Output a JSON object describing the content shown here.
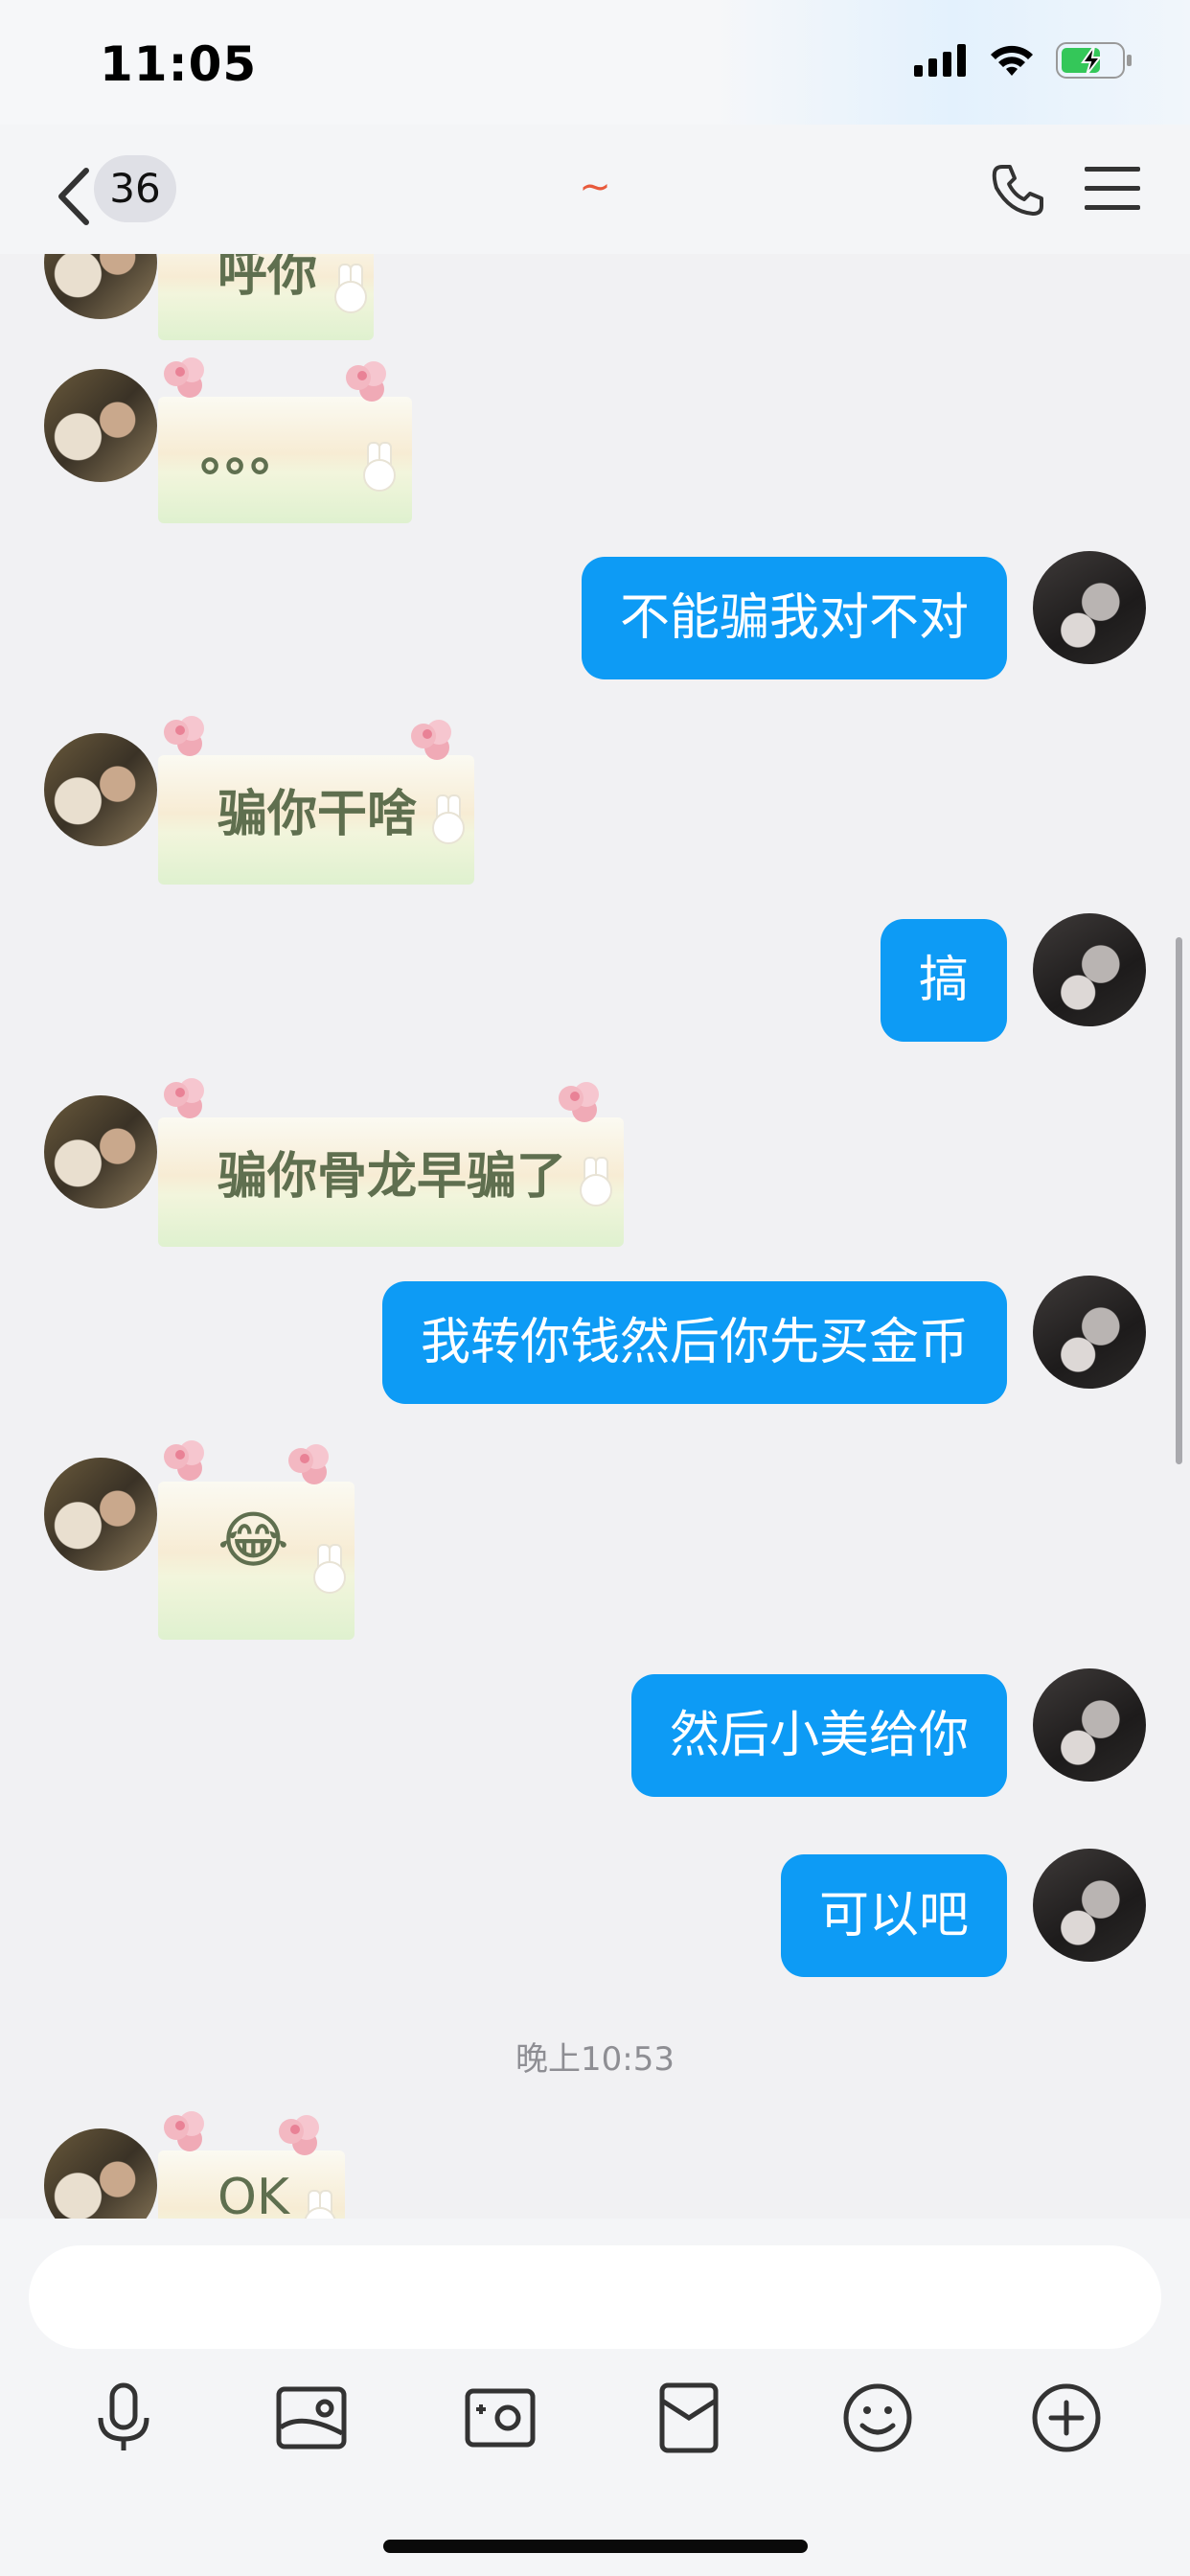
{
  "status_bar": {
    "time": "11:05"
  },
  "nav": {
    "badge_count": "36",
    "title": "~"
  },
  "messages": [
    {
      "side": "left",
      "kind": "sticker",
      "text": "呼你"
    },
    {
      "side": "left",
      "kind": "sticker",
      "text": "。。。"
    },
    {
      "side": "right",
      "kind": "text",
      "text": "不能骗我对不对"
    },
    {
      "side": "left",
      "kind": "sticker",
      "text": "骗你干啥"
    },
    {
      "side": "right",
      "kind": "text",
      "text": "搞"
    },
    {
      "side": "left",
      "kind": "sticker",
      "text": "骗你骨龙早骗了"
    },
    {
      "side": "right",
      "kind": "text",
      "text": "我转你钱然后你先买金币"
    },
    {
      "side": "left",
      "kind": "sticker",
      "text": "😂"
    },
    {
      "side": "right",
      "kind": "text",
      "text": "然后小美给你"
    },
    {
      "side": "right",
      "kind": "text",
      "text": "可以吧"
    },
    {
      "side": "left",
      "kind": "sticker",
      "text": "OK"
    }
  ],
  "timestamp": "晚上10:53",
  "toolbar": {
    "icons": [
      "microphone-icon",
      "image-icon",
      "camera-icon",
      "red-packet-icon",
      "emoji-icon",
      "plus-icon"
    ]
  },
  "colors": {
    "accent": "#0d9bf5",
    "background": "#f1f1f3",
    "title": "#e85a3c"
  }
}
